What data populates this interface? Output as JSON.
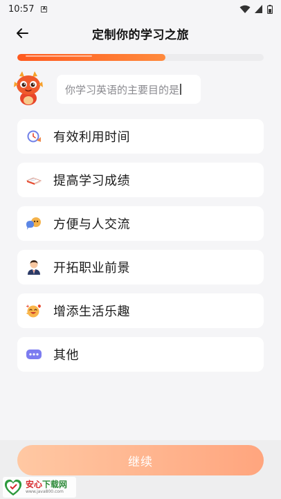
{
  "status_bar": {
    "time": "10:57",
    "notification_glyph": "A",
    "icons": [
      "wifi-icon",
      "signal-icon",
      "battery-icon"
    ]
  },
  "header": {
    "title": "定制你的学习之旅",
    "back_icon": "arrow-left-icon"
  },
  "progress": {
    "value": 0.6,
    "color": "#ff5a1f"
  },
  "question": {
    "text": "你学习英语的主要目的是"
  },
  "options": [
    {
      "label": "有效利用时间",
      "icon": "clock-icon"
    },
    {
      "label": "提高学习成绩",
      "icon": "book-icon"
    },
    {
      "label": "方便与人交流",
      "icon": "chat-bubbles-icon"
    },
    {
      "label": "开拓职业前景",
      "icon": "businessman-icon"
    },
    {
      "label": "增添生活乐趣",
      "icon": "happy-face-icon"
    },
    {
      "label": "其他",
      "icon": "more-dots-icon"
    }
  ],
  "continue_button": {
    "label": "继续",
    "color": "#ffa57e"
  },
  "watermark": {
    "name_prefix": "安心",
    "name_suffix": "下载网",
    "url": "www.java800.com"
  },
  "colors": {
    "accent": "#ff5a1f",
    "background": "#f5f5f7",
    "button_gradient_start": "#ffc8a3",
    "button_gradient_end": "#ffa57e"
  }
}
